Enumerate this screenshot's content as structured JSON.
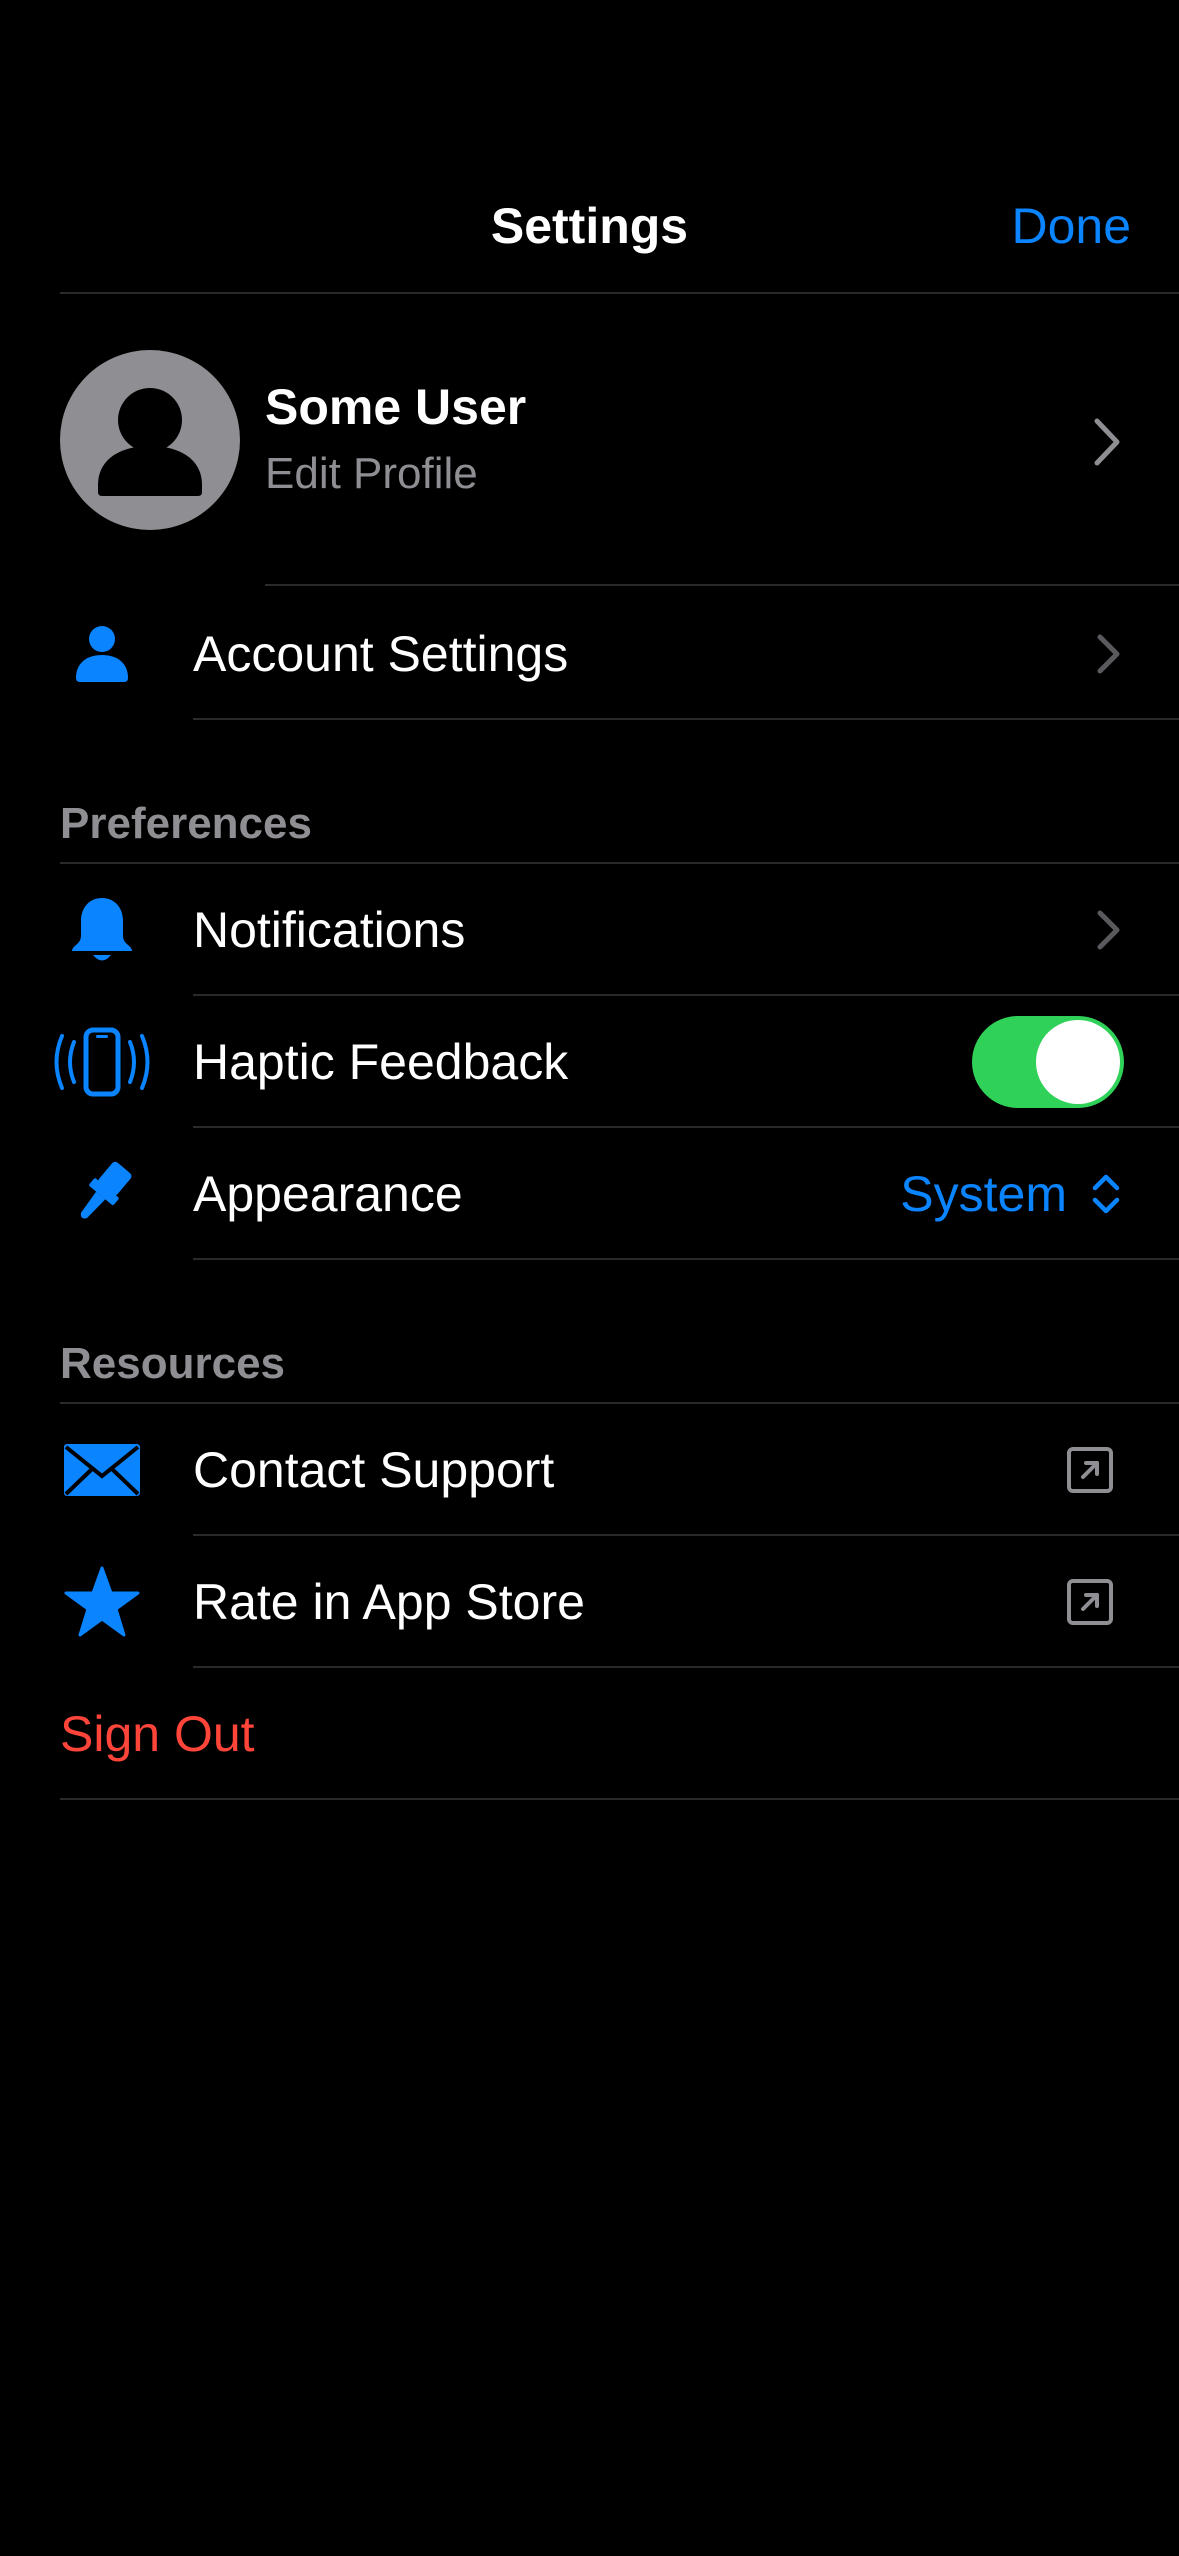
{
  "header": {
    "title": "Settings",
    "done_label": "Done"
  },
  "profile": {
    "name": "Some User",
    "subtitle": "Edit Profile"
  },
  "account": {
    "label": "Account Settings",
    "icon": "person-icon"
  },
  "preferences": {
    "header": "Preferences",
    "items": [
      {
        "label": "Notifications",
        "icon": "bell-icon"
      },
      {
        "label": "Haptic Feedback",
        "icon": "phone-vibrate-icon",
        "toggle_on": true
      },
      {
        "label": "Appearance",
        "icon": "paintbrush-icon",
        "value": "System"
      }
    ]
  },
  "resources": {
    "header": "Resources",
    "items": [
      {
        "label": "Contact Support",
        "icon": "envelope-icon"
      },
      {
        "label": "Rate in App Store",
        "icon": "star-icon"
      }
    ]
  },
  "sign_out_label": "Sign Out",
  "colors": {
    "background": "#000000",
    "accent": "#0a84ff",
    "toggle_on": "#30d158",
    "destructive": "#ff453a",
    "secondary_text": "#8e8e93",
    "separator": "#2a2a2c"
  }
}
